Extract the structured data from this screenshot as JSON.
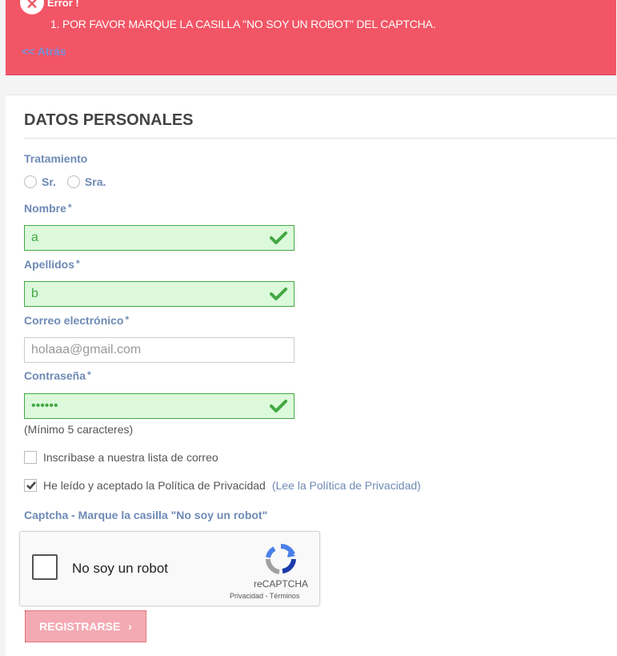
{
  "error": {
    "title": "Error !",
    "message": "1. POR FAVOR MARQUE LA CASILLA \"NO SOY UN ROBOT\" DEL CAPTCHA.",
    "back_link": "<< Atrás"
  },
  "form": {
    "section_title": "DATOS PERSONALES",
    "tratamiento_label": "Tratamiento",
    "tratamiento_options": [
      "Sr.",
      "Sra."
    ],
    "nombre": {
      "label": "Nombre",
      "value": "a"
    },
    "apellidos": {
      "label": "Apellidos",
      "value": "b"
    },
    "correo": {
      "label": "Correo electrónico",
      "placeholder": "holaaa@gmail.com"
    },
    "contrasena": {
      "label": "Contraseña",
      "value": "••••••",
      "hint": "(Mínimo 5 caracteres)"
    },
    "required_mark": "*",
    "newsletter_label": "Inscríbase a nuestra lista de correo",
    "privacy": {
      "label": "He leído y aceptado la Política de Privacidad",
      "link": "(Lee la Política de Privacidad)"
    },
    "captcha_label": "Captcha - Marque la casilla \"No soy un robot\"",
    "recaptcha": {
      "checkbox_label": "No soy un robot",
      "brand": "reCAPTCHA",
      "links": "Privacidad - Términos"
    },
    "submit_label": "REGISTRARSE"
  },
  "colors": {
    "error_bg": "#f25565",
    "label": "#6e8ab5",
    "valid_bg": "#dcf9dc",
    "valid_border": "#42a842",
    "button_bg": "#f4aab2"
  }
}
